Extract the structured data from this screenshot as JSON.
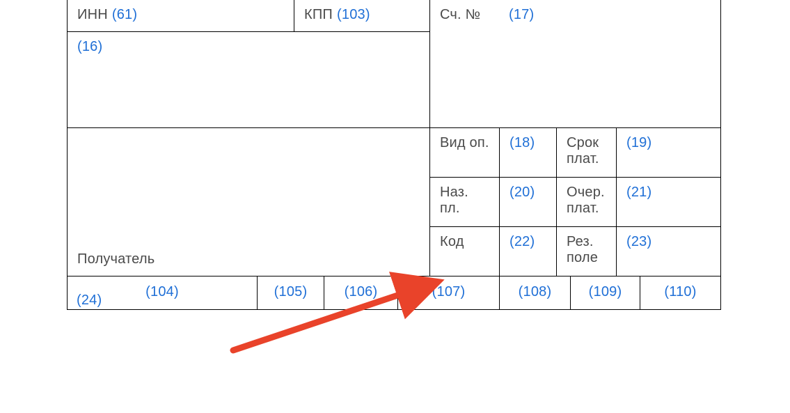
{
  "labels": {
    "inn": "ИНН",
    "kpp": "КПП",
    "sch": "Сч. №",
    "vid_op": "Вид оп.",
    "srok_plat_l1": "Срок",
    "srok_plat_l2": "плат.",
    "naz_pl": "Наз. пл.",
    "ocher_plat_l1": "Очер.",
    "ocher_plat_l2": "плат.",
    "kod": "Код",
    "rez_pole_l1": "Рез.",
    "rez_pole_l2": "поле",
    "recipient": "Получатель"
  },
  "refs": {
    "inn": "(61)",
    "kpp": "(103)",
    "f16": "(16)",
    "sch": "(17)",
    "vid_op": "(18)",
    "srok_plat": "(19)",
    "naz_pl": "(20)",
    "ocher_plat": "(21)",
    "kod": "(22)",
    "rez_pole": "(23)",
    "f24": "(24)",
    "c104": "(104)",
    "c105": "(105)",
    "c106": "(106)",
    "c107": "(107)",
    "c108": "(108)",
    "c109": "(109)",
    "c110": "(110)"
  },
  "annotation": {
    "arrow_target_field": "107"
  }
}
